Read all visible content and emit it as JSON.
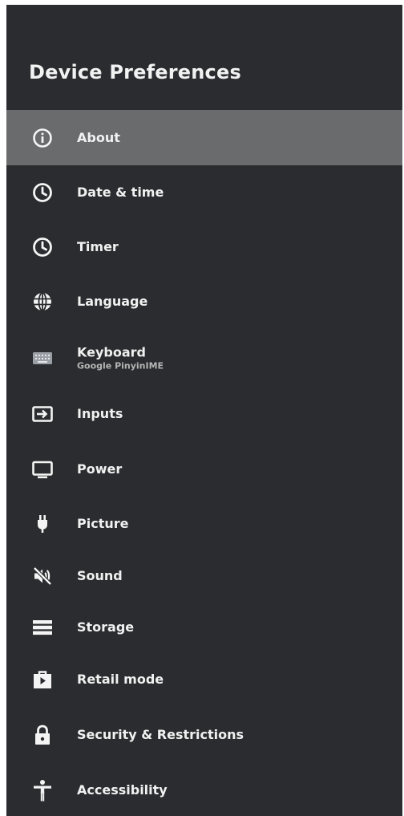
{
  "page": {
    "title": "Device Preferences"
  },
  "menu": {
    "items": [
      {
        "label": "About",
        "icon": "info-icon"
      },
      {
        "label": "Date & time",
        "icon": "clock-icon"
      },
      {
        "label": "Timer",
        "icon": "clock-icon"
      },
      {
        "label": "Language",
        "icon": "globe-icon"
      },
      {
        "label": "Keyboard",
        "sublabel": "Google PinyinIME",
        "icon": "keyboard-icon"
      },
      {
        "label": "Inputs",
        "icon": "input-icon"
      },
      {
        "label": "Power",
        "icon": "tv-icon"
      },
      {
        "label": "Picture",
        "icon": "plug-icon"
      },
      {
        "label": "Sound",
        "icon": "mute-icon"
      },
      {
        "label": "Storage",
        "icon": "storage-icon"
      },
      {
        "label": "Retail mode",
        "icon": "store-icon"
      },
      {
        "label": "Security & Restrictions",
        "icon": "lock-icon"
      },
      {
        "label": "Accessibility",
        "icon": "accessibility-icon"
      }
    ],
    "selected_index": 0
  },
  "colors": {
    "panel_background": "#2a2c2f",
    "selected_background": "#696b6d",
    "text": "#f1f1f1"
  }
}
